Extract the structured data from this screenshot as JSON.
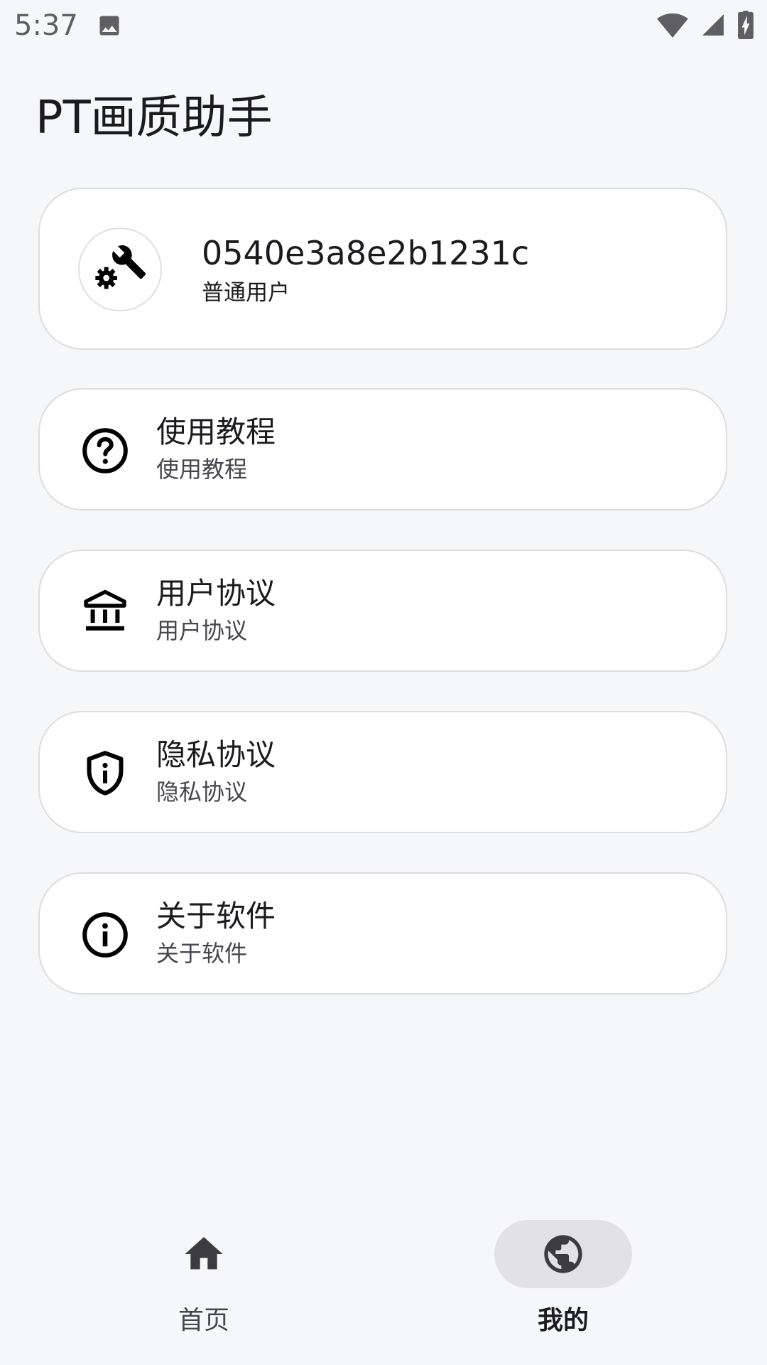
{
  "status_bar": {
    "time": "5:37",
    "icons": [
      "image-icon",
      "wifi-icon",
      "signal-icon",
      "battery-charging-icon"
    ]
  },
  "page": {
    "title": "PT画质助手"
  },
  "profile": {
    "avatar_icon": "tools-gear-icon",
    "user_id": "0540e3a8e2b1231c",
    "role": "普通用户"
  },
  "menu": [
    {
      "icon": "help-circle-icon",
      "title": "使用教程",
      "subtitle": "使用教程"
    },
    {
      "icon": "bank-icon",
      "title": "用户协议",
      "subtitle": "用户协议"
    },
    {
      "icon": "shield-info-icon",
      "title": "隐私协议",
      "subtitle": "隐私协议"
    },
    {
      "icon": "info-icon",
      "title": "关于软件",
      "subtitle": "关于软件"
    }
  ],
  "bottom_nav": {
    "items": [
      {
        "icon": "home-icon",
        "label": "首页",
        "selected": false
      },
      {
        "icon": "globe-icon",
        "label": "我的",
        "selected": true
      }
    ]
  },
  "colors": {
    "background": "#f6f7f9",
    "card": "#ffffff",
    "selected_pill": "#e2e2e6",
    "text": "#1b1b1f"
  }
}
